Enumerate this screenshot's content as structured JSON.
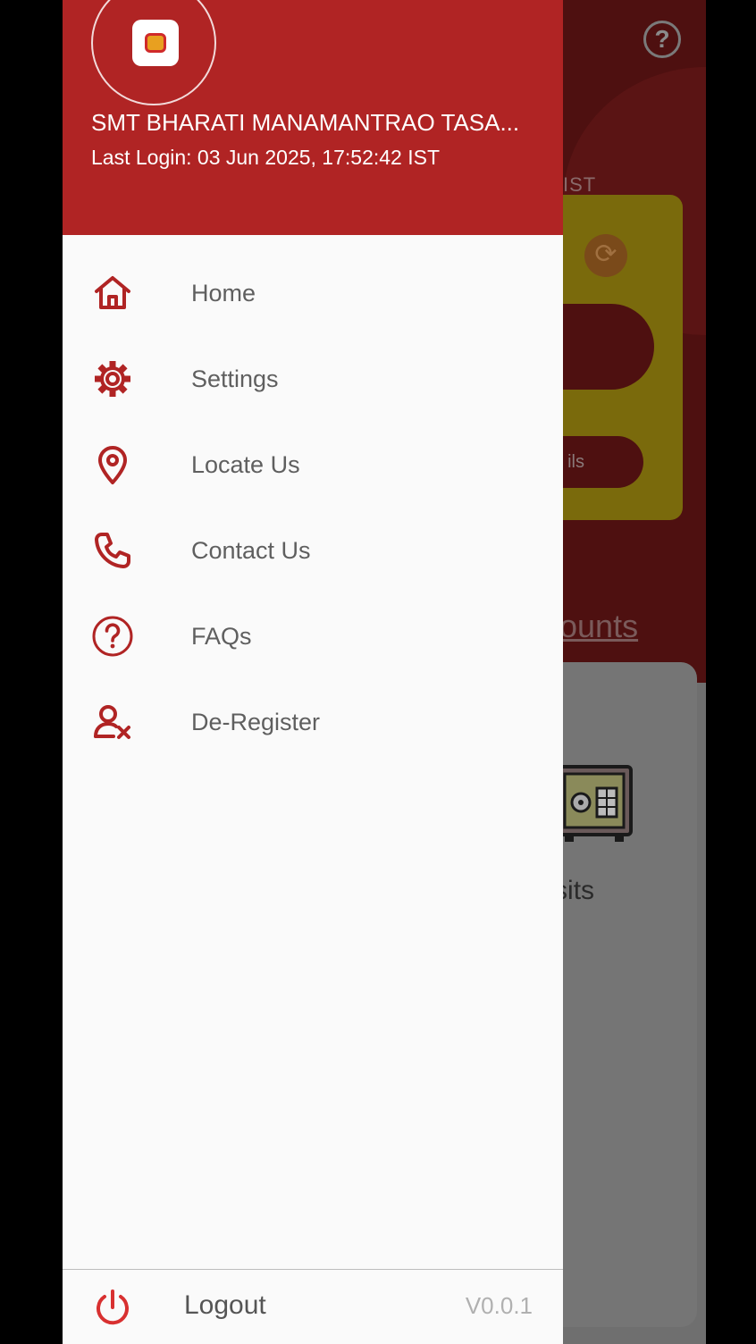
{
  "colors": {
    "brand_red": "#b02424",
    "icon_red": "#b02424",
    "drawer_bg": "#fafafa",
    "menu_text": "#5f5f5f",
    "version_text": "#b0b0b0"
  },
  "background": {
    "help_icon": "question-circle-icon",
    "help_glyph": "?",
    "time_suffix": "IST",
    "refresh_icon": "refresh-icon",
    "refresh_glyph": "⟳",
    "details_partial": "ils",
    "accounts_partial": "ccounts",
    "deposits_icon": "safe-icon",
    "deposits_partial": "eposits"
  },
  "drawer": {
    "user_name": "SMT BHARATI MANAMANTRAO TASA...",
    "last_login": "Last Login: 03 Jun 2025, 17:52:42 IST",
    "menu": [
      {
        "label": "Home",
        "icon": "home-icon"
      },
      {
        "label": "Settings",
        "icon": "gear-icon"
      },
      {
        "label": "Locate Us",
        "icon": "location-pin-icon"
      },
      {
        "label": "Contact Us",
        "icon": "phone-icon"
      },
      {
        "label": "FAQs",
        "icon": "question-circle-icon"
      },
      {
        "label": "De-Register",
        "icon": "user-remove-icon"
      }
    ],
    "footer": {
      "logout_label": "Logout",
      "logout_icon": "power-icon",
      "version": "V0.0.1"
    }
  }
}
